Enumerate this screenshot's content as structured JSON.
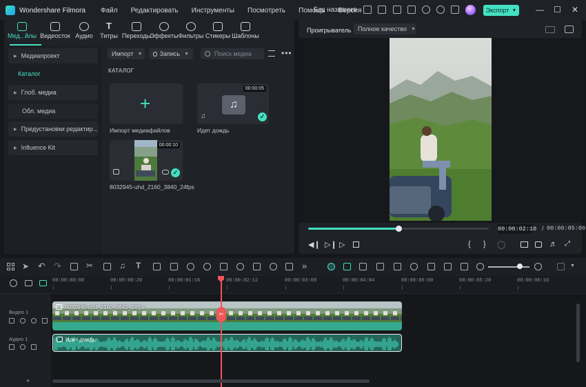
{
  "titlebar": {
    "app_name": "Wondershare Filmora",
    "menu": [
      "Файл",
      "Редактировать",
      "Инструменты",
      "Посмотреть",
      "Помощь",
      "Версия"
    ],
    "project_name": "Без названия",
    "export_label": "Экспорт"
  },
  "media_tabs": [
    {
      "label": "Мед...йлы",
      "icon": "media-icon",
      "active": true
    },
    {
      "label": "Видеосток",
      "icon": "stock-video-icon"
    },
    {
      "label": "Аудио",
      "icon": "music-note-icon"
    },
    {
      "label": "Титры",
      "icon": "title-text-icon"
    },
    {
      "label": "Переходы",
      "icon": "transition-icon"
    },
    {
      "label": "Эффекты",
      "icon": "effects-sparkle-icon"
    },
    {
      "label": "Фильтры",
      "icon": "filter-icon"
    },
    {
      "label": "Стикеры",
      "icon": "sticker-icon"
    },
    {
      "label": "Шаблоны",
      "icon": "template-icon"
    }
  ],
  "sidebar": {
    "items": [
      {
        "label": "Медиапроект",
        "expandable": true
      },
      {
        "label": "Каталог",
        "active": true
      },
      {
        "label": "Глоб. медиа",
        "expandable": true
      },
      {
        "label": "Обл. медиа"
      },
      {
        "label": "Предустановки редактир...",
        "expandable": true
      },
      {
        "label": "Influence Kit",
        "expandable": true
      }
    ]
  },
  "media_toolbar": {
    "import_label": "Импорт",
    "record_label": "Запись",
    "search_placeholder": "Поиск медиа"
  },
  "catalog": {
    "heading": "КАТАЛОГ",
    "items": [
      {
        "caption": "Импорт медиафайлов",
        "type": "import"
      },
      {
        "caption": "Идет дождь",
        "type": "audio",
        "duration": "00:00:05",
        "used": true
      },
      {
        "caption": "8032945-uhd_2160_3840_24fps",
        "type": "video",
        "duration": "00:00:10",
        "used": true
      }
    ]
  },
  "player": {
    "label": "Проигрыватель",
    "quality": "Полное качество",
    "current_time": "00:00:02:10",
    "separator": "/",
    "total_time": "00:00:05:00",
    "progress": 0.5
  },
  "timeline": {
    "ruler_labels": [
      "00:00:00:00",
      "00:00:00:20",
      "00:00:01:16",
      "00:00:02:12",
      "00:00:03:08",
      "00:00:04:04",
      "00:00:05:00",
      "00:00:05:20",
      "00:00:06:16"
    ],
    "tracks": [
      {
        "name": "Видео 1",
        "clip_label": "8032945-uhd_2160_3840_24fps"
      },
      {
        "name": "Аудио 1",
        "clip_label": "Идет дождь"
      }
    ],
    "playhead_time": "00:00:02:12"
  },
  "colors": {
    "accent": "#43e0c2",
    "playhead": "#f2565a",
    "panel": "#1f2227",
    "background": "#15171b"
  }
}
